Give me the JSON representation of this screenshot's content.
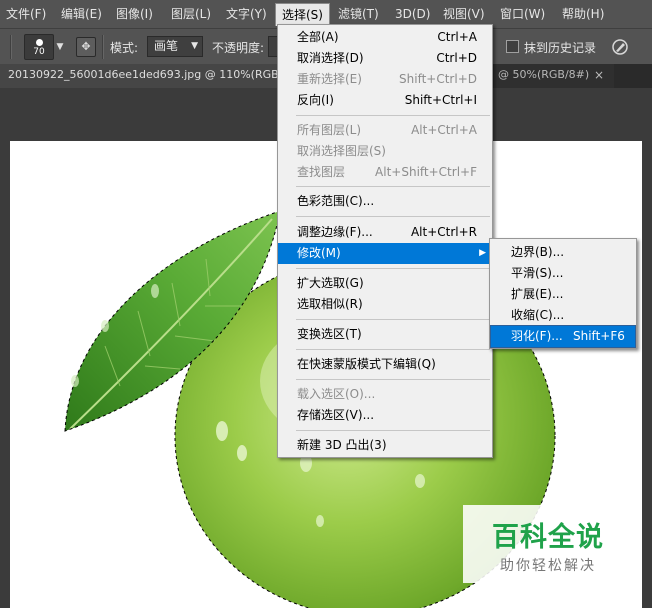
{
  "menubar": {
    "items": [
      "文件(F)",
      "编辑(E)",
      "图像(I)",
      "图层(L)",
      "文字(Y)",
      "选择(S)",
      "滤镜(T)",
      "3D(D)",
      "视图(V)",
      "窗口(W)",
      "帮助(H)"
    ]
  },
  "options_bar": {
    "brush_size": "70",
    "mode_label": "模式:",
    "mode_value": "画笔",
    "opacity_label": "不透明度:",
    "history_label": "抹到历史记录"
  },
  "tabs": {
    "doc1": "20130922_56001d6ee1ded693.jpg @ 110%(RGB/8#)",
    "doc2": "@ 50%(RGB/8#)",
    "doc2_close": "×"
  },
  "select_menu": {
    "items": [
      {
        "label": "全部(A)",
        "shortcut": "Ctrl+A",
        "disabled": false
      },
      {
        "label": "取消选择(D)",
        "shortcut": "Ctrl+D",
        "disabled": false
      },
      {
        "label": "重新选择(E)",
        "shortcut": "Shift+Ctrl+D",
        "disabled": true
      },
      {
        "label": "反向(I)",
        "shortcut": "Shift+Ctrl+I",
        "disabled": false
      },
      {
        "label": "所有图层(L)",
        "shortcut": "Alt+Ctrl+A",
        "disabled": true
      },
      {
        "label": "取消选择图层(S)",
        "shortcut": "",
        "disabled": true
      },
      {
        "label": "查找图层",
        "shortcut": "Alt+Shift+Ctrl+F",
        "disabled": true
      },
      {
        "label": "色彩范围(C)...",
        "shortcut": "",
        "disabled": false
      },
      {
        "label": "调整边缘(F)...",
        "shortcut": "Alt+Ctrl+R",
        "disabled": false
      },
      {
        "label": "修改(M)",
        "shortcut": "",
        "disabled": false
      },
      {
        "label": "扩大选取(G)",
        "shortcut": "",
        "disabled": false
      },
      {
        "label": "选取相似(R)",
        "shortcut": "",
        "disabled": false
      },
      {
        "label": "变换选区(T)",
        "shortcut": "",
        "disabled": false
      },
      {
        "label": "在快速蒙版模式下编辑(Q)",
        "shortcut": "",
        "disabled": false
      },
      {
        "label": "载入选区(O)...",
        "shortcut": "",
        "disabled": true
      },
      {
        "label": "存储选区(V)...",
        "shortcut": "",
        "disabled": false
      },
      {
        "label": "新建 3D 凸出(3)",
        "shortcut": "",
        "disabled": false
      }
    ]
  },
  "modify_submenu": {
    "items": [
      {
        "label": "边界(B)...",
        "shortcut": ""
      },
      {
        "label": "平滑(S)...",
        "shortcut": ""
      },
      {
        "label": "扩展(E)...",
        "shortcut": ""
      },
      {
        "label": "收缩(C)...",
        "shortcut": ""
      },
      {
        "label": "羽化(F)...",
        "shortcut": "Shift+F6"
      }
    ]
  },
  "watermark": {
    "title": "百科全说",
    "subtitle": "助你轻松解决"
  },
  "colors": {
    "menu_highlight": "#0078d7",
    "apple_green": "#8cc63f",
    "leaf_green": "#4a9a2a"
  }
}
